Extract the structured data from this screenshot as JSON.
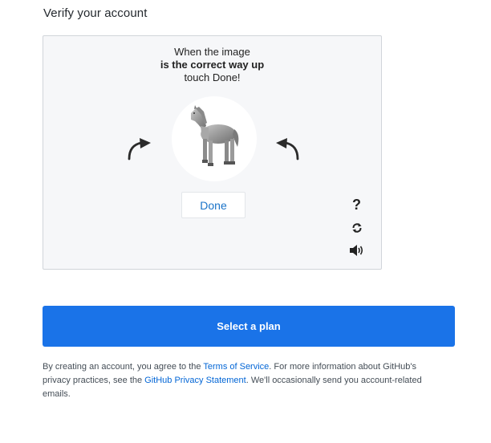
{
  "page": {
    "heading": "Verify your account"
  },
  "captcha": {
    "instruction_line1": "When the image",
    "instruction_line2": "is the correct way up",
    "instruction_line3": "touch Done!",
    "image": "horse",
    "done_label": "Done",
    "help_label": "?",
    "icons": {
      "rotate_left": "rotate-left-arrow-icon",
      "rotate_right": "rotate-right-arrow-icon",
      "help": "question-mark-icon",
      "refresh": "refresh-icon",
      "audio": "speaker-icon"
    }
  },
  "plan_button": {
    "label": "Select a plan",
    "color": "#1a73e8"
  },
  "terms": {
    "text1": "By creating an account, you agree to the ",
    "link1": "Terms of Service",
    "text2": ". For more information about GitHub's privacy practices, see the ",
    "link2": "GitHub Privacy Statement",
    "text3": ". We'll occasionally send you account-related emails.",
    "link_color": "#0366d6"
  }
}
